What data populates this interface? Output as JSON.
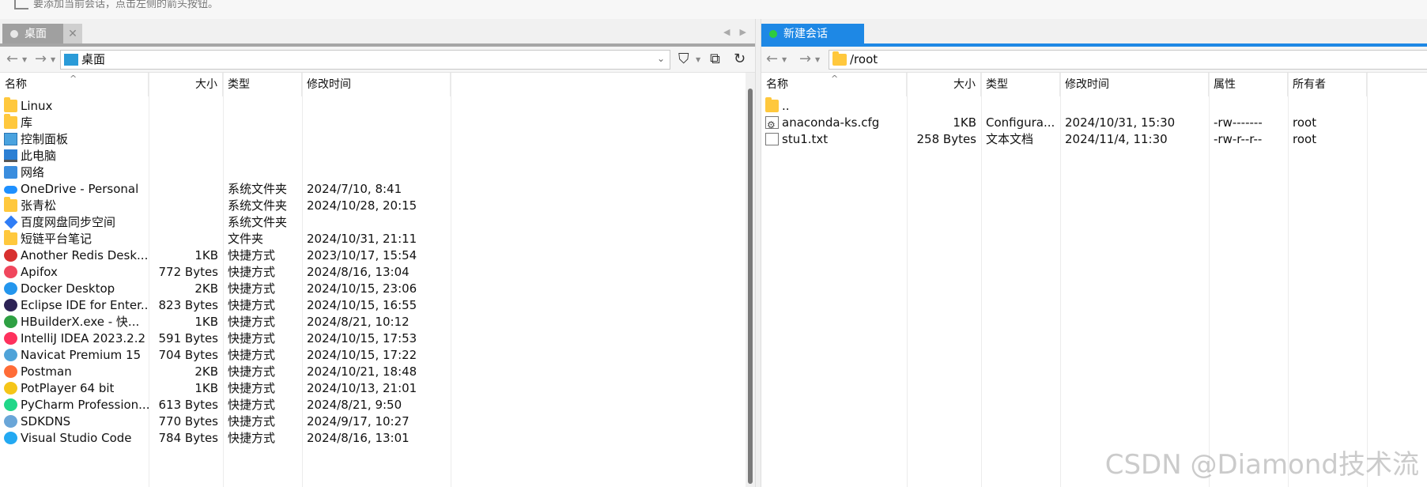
{
  "hint": "要添加当前会话，点击左侧的箭头按钮。",
  "tabs": {
    "left": {
      "label": "桌面"
    },
    "right": {
      "label": "新建会话"
    }
  },
  "left_pane": {
    "path": "桌面",
    "columns": {
      "name": "名称",
      "size": "大小",
      "type": "类型",
      "mtime": "修改时间"
    },
    "rows": [
      {
        "name": "Linux",
        "size": "",
        "type": "",
        "mtime": "",
        "icon": "folder-icon"
      },
      {
        "name": "库",
        "size": "",
        "type": "",
        "mtime": "",
        "icon": "folder-icon"
      },
      {
        "name": "控制面板",
        "size": "",
        "type": "",
        "mtime": "",
        "icon": "control-panel-icon"
      },
      {
        "name": "此电脑",
        "size": "",
        "type": "",
        "mtime": "",
        "icon": "computer-icon"
      },
      {
        "name": "网络",
        "size": "",
        "type": "",
        "mtime": "",
        "icon": "network-icon"
      },
      {
        "name": "OneDrive - Personal",
        "size": "",
        "type": "系统文件夹",
        "mtime": "2024/7/10, 8:41",
        "icon": "onedrive-icon"
      },
      {
        "name": "张青松",
        "size": "",
        "type": "系统文件夹",
        "mtime": "2024/10/28, 20:15",
        "icon": "folder-icon"
      },
      {
        "name": "百度网盘同步空间",
        "size": "",
        "type": "系统文件夹",
        "mtime": "",
        "icon": "baidu-netdisk-icon"
      },
      {
        "name": "短链平台笔记",
        "size": "",
        "type": "文件夹",
        "mtime": "2024/10/31, 21:11",
        "icon": "folder-icon"
      },
      {
        "name": "Another Redis Desk...",
        "size": "1KB",
        "type": "快捷方式",
        "mtime": "2023/10/17, 15:54",
        "icon": "redis-icon"
      },
      {
        "name": "Apifox",
        "size": "772 Bytes",
        "type": "快捷方式",
        "mtime": "2024/8/16, 13:04",
        "icon": "apifox-icon"
      },
      {
        "name": "Docker Desktop",
        "size": "2KB",
        "type": "快捷方式",
        "mtime": "2024/10/15, 23:06",
        "icon": "docker-icon"
      },
      {
        "name": "Eclipse IDE for Enter...",
        "size": "823 Bytes",
        "type": "快捷方式",
        "mtime": "2024/10/15, 16:55",
        "icon": "eclipse-icon"
      },
      {
        "name": "HBuilderX.exe - 快...",
        "size": "1KB",
        "type": "快捷方式",
        "mtime": "2024/8/21, 10:12",
        "icon": "hbuilderx-icon"
      },
      {
        "name": "IntelliJ IDEA 2023.2.2",
        "size": "591 Bytes",
        "type": "快捷方式",
        "mtime": "2024/10/15, 17:53",
        "icon": "intellij-icon"
      },
      {
        "name": "Navicat Premium 15",
        "size": "704 Bytes",
        "type": "快捷方式",
        "mtime": "2024/10/15, 17:22",
        "icon": "navicat-icon"
      },
      {
        "name": "Postman",
        "size": "2KB",
        "type": "快捷方式",
        "mtime": "2024/10/21, 18:48",
        "icon": "postman-icon"
      },
      {
        "name": "PotPlayer 64 bit",
        "size": "1KB",
        "type": "快捷方式",
        "mtime": "2024/10/13, 21:01",
        "icon": "potplayer-icon"
      },
      {
        "name": "PyCharm Profession...",
        "size": "613 Bytes",
        "type": "快捷方式",
        "mtime": "2024/8/21, 9:50",
        "icon": "pycharm-icon"
      },
      {
        "name": "SDKDNS",
        "size": "770 Bytes",
        "type": "快捷方式",
        "mtime": "2024/9/17, 10:27",
        "icon": "sdkdns-icon"
      },
      {
        "name": "Visual Studio Code",
        "size": "784 Bytes",
        "type": "快捷方式",
        "mtime": "2024/8/16, 13:01",
        "icon": "vscode-icon"
      }
    ]
  },
  "right_pane": {
    "path": "/root",
    "columns": {
      "name": "名称",
      "size": "大小",
      "type": "类型",
      "mtime": "修改时间",
      "attr": "属性",
      "owner": "所有者"
    },
    "rows": [
      {
        "name": "..",
        "size": "",
        "type": "",
        "mtime": "",
        "attr": "",
        "owner": "",
        "icon": "folder-icon"
      },
      {
        "name": "anaconda-ks.cfg",
        "size": "1KB",
        "type": "Configura...",
        "mtime": "2024/10/31, 15:30",
        "attr": "-rw-------",
        "owner": "root",
        "icon": "config-file-icon"
      },
      {
        "name": "stu1.txt",
        "size": "258 Bytes",
        "type": "文本文档",
        "mtime": "2024/11/4, 11:30",
        "attr": "-rw-r--r--",
        "owner": "root",
        "icon": "text-file-icon"
      }
    ]
  },
  "watermark": "CSDN @Diamond技术流",
  "colors": {
    "accent": "#1e88e5",
    "tab_inactive": "#a0a0a0",
    "folder": "#ffc83d"
  }
}
